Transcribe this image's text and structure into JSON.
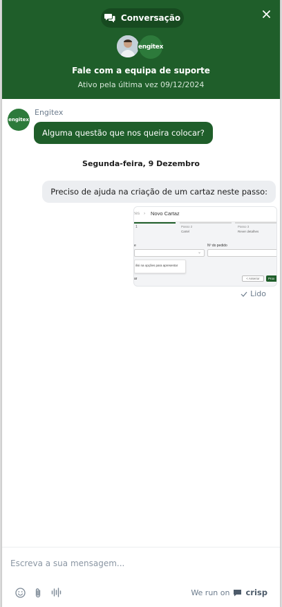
{
  "header": {
    "tab_label": "Conversação",
    "title": "Fale com a equipa de suporte",
    "subtitle": "Ativo pela última vez 09/12/2024",
    "logo_text": "engitex"
  },
  "messages": {
    "operator_name": "Engitex",
    "operator_avatar_text": "engitex",
    "operator_message": "Alguma questão que nos queira colocar?",
    "date_separator": "Segunda-feira, 9 Dezembro",
    "user_message": "Preciso de ajuda na criação de um cartaz neste passo:",
    "read_status": "Lido"
  },
  "attachment": {
    "breadcrumb_prev": "zes",
    "breadcrumb_current": "Novo Cartaz",
    "step1": "1",
    "step2_title": "Passo 2",
    "step2_label": "Cartel",
    "step3_title": "Passo 3",
    "step3_label": "Rever detalhes",
    "field_label_left": "e",
    "field_label_right": "Nº do pedido",
    "suggestion_text": "ilisi na opções para apresentar",
    "footer_left": "ar",
    "back_button": "< Anterior",
    "next_button": "Prox"
  },
  "composer": {
    "placeholder": "Escreva a sua mensagem...",
    "brand_prefix": "We run on",
    "brand_name": "crisp"
  },
  "colors": {
    "brand_green": "#1f5e2a",
    "user_bubble": "#eceef1"
  },
  "icons": [
    "chat-bubbles-icon",
    "close-icon",
    "check-icon",
    "emoji-icon",
    "paperclip-icon",
    "audio-wave-icon",
    "crisp-logo-icon"
  ]
}
